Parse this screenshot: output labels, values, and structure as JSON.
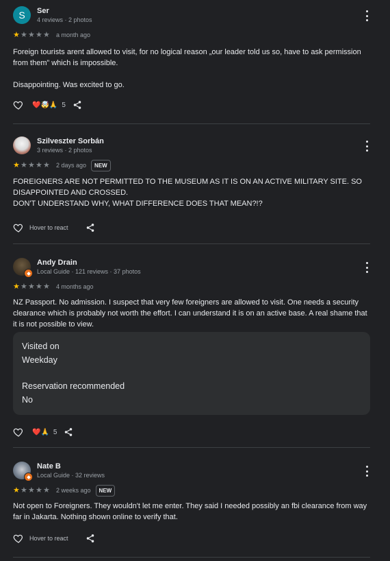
{
  "reviews": [
    {
      "name": "Ser",
      "meta": "4 reviews · 2 photos",
      "avatar_letter": "S",
      "avatar_color": "#0b8a9c",
      "stars": 1,
      "date": "a month ago",
      "text": "Foreign tourists arent allowed to visit, for no logical reason „our leader told us so, have to ask permission from them” which is impossible.\n\nDisappointing. Was excited to go.",
      "reactions": "❤️🤯🙏",
      "reaction_count": "5"
    },
    {
      "name": "Szilveszter Sorbán",
      "meta": "3 reviews · 2 photos",
      "stars": 1,
      "date": "2 days ago",
      "badge": "NEW",
      "text": "FOREIGNERS ARE NOT PERMITTED TO THE MUSEUM AS IT IS ON AN ACTIVE MILITARY SITE. SO DISAPPOINTED AND CROSSED.\nDON'T UNDERSTAND WHY, WHAT DIFFERENCE DOES THAT MEAN?!?",
      "hover_text": "Hover to react"
    },
    {
      "name": "Andy Drain",
      "meta": "Local Guide · 121 reviews · 37 photos",
      "stars": 1,
      "date": "4 months ago",
      "text": "NZ Passport. No admission. I suspect that very few foreigners are allowed to visit. One needs a security clearance which is probably not worth the effort. I can understand it is on an active base. A real shame that it is not possible to view.",
      "visited_label": "Visited on",
      "visited_value": "Weekday",
      "reservation_label": "Reservation recommended",
      "reservation_value": "No",
      "reactions": "❤️🙏",
      "reaction_count": "5"
    },
    {
      "name": "Nate B",
      "meta": "Local Guide · 32 reviews",
      "stars": 1,
      "date": "2 weeks ago",
      "badge": "NEW",
      "text": "Not open to Foreigners. They wouldn't let me enter. They said I needed possibly an fbi clearance from way far in Jakarta. Nothing shown online to verify that.",
      "hover_text": "Hover to react"
    }
  ],
  "colors": {
    "background": "#202124",
    "star_filled": "#fbbc04",
    "star_empty": "#80868b",
    "local_guide_badge": "#e8711c"
  },
  "icons": [
    "more-vert-icon",
    "heart-outline-icon",
    "share-icon",
    "star-icon",
    "local-guide-badge-icon"
  ]
}
